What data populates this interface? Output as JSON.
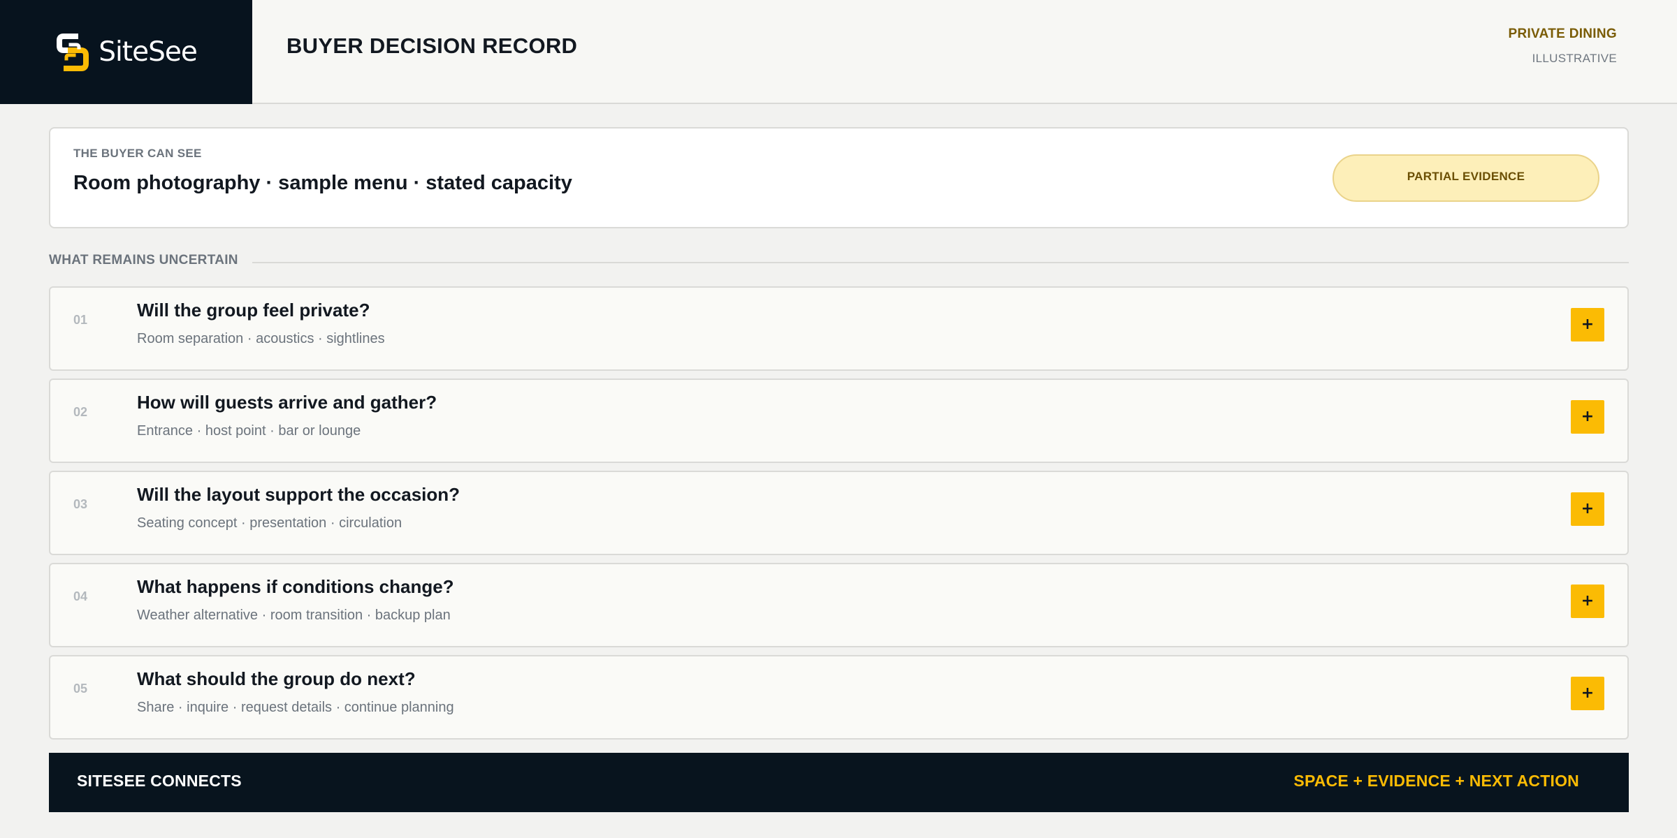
{
  "header": {
    "brand_name": "SiteSee",
    "brand_icon": "sitesee-logo-icon",
    "title": "BUYER DECISION RECORD",
    "kicker": "PRIVATE DINING",
    "subtitle": "ILLUSTRATIVE"
  },
  "evidence": {
    "label": "THE BUYER CAN SEE",
    "text": "Room photography · sample menu · stated capacity",
    "badge": "PARTIAL EVIDENCE"
  },
  "section": {
    "title": "WHAT REMAINS UNCERTAIN"
  },
  "questions": [
    {
      "num": "01",
      "title": "Will the group feel private?",
      "detail": "Room separation · acoustics · sightlines",
      "action": "+"
    },
    {
      "num": "02",
      "title": "How will guests arrive and gather?",
      "detail": "Entrance · host point · bar or lounge",
      "action": "+"
    },
    {
      "num": "03",
      "title": "Will the layout support the occasion?",
      "detail": "Seating concept · presentation · circulation",
      "action": "+"
    },
    {
      "num": "04",
      "title": "What happens if conditions change?",
      "detail": "Weather alternative · room transition · backup plan",
      "action": "+"
    },
    {
      "num": "05",
      "title": "What should the group do next?",
      "detail": "Share · inquire · request details · continue planning",
      "action": "+"
    }
  ],
  "footer": {
    "left": "SITESEE CONNECTS",
    "right": "SPACE + EVIDENCE + NEXT ACTION"
  },
  "colors": {
    "navy": "#07131e",
    "accent_yellow": "#fbbb04",
    "badge_fill": "#fdefb9",
    "kicker_gold": "#7a5c06",
    "muted_text": "#6b737c"
  }
}
